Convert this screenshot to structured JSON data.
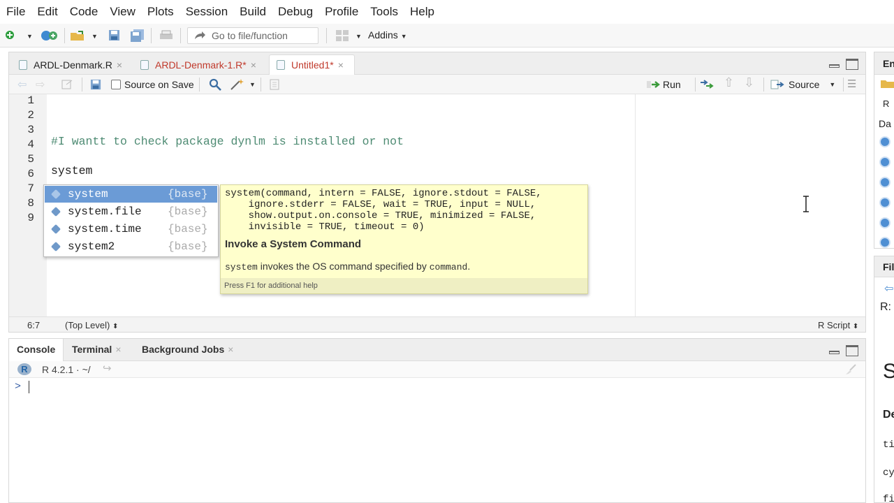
{
  "menu": [
    "File",
    "Edit",
    "Code",
    "View",
    "Plots",
    "Session",
    "Build",
    "Debug",
    "Profile",
    "Tools",
    "Help"
  ],
  "toolbar": {
    "goto_placeholder": "Go to file/function",
    "addins_label": "Addins"
  },
  "editor": {
    "tabs": [
      {
        "label": "ARDL-Denmark.R",
        "unsaved": false
      },
      {
        "label": "ARDL-Denmark-1.R*",
        "unsaved": true
      },
      {
        "label": "Untitled1*",
        "unsaved": true,
        "active": true
      }
    ],
    "toolbar": {
      "source_on_save": "Source on Save",
      "run": "Run",
      "source": "Source"
    },
    "line_numbers": [
      "1",
      "2",
      "3",
      "4",
      "5",
      "6",
      "7",
      "8",
      "9"
    ],
    "lines": [
      "",
      "",
      "",
      "#I wantt to check package dynlm is installed or not",
      "",
      "system",
      "",
      "",
      ""
    ],
    "status": {
      "position": "6:7",
      "scope": "(Top Level)",
      "file_type": "R Script"
    }
  },
  "autocomplete": {
    "items": [
      {
        "name": "system",
        "pkg": "{base}",
        "selected": true
      },
      {
        "name": "system.file",
        "pkg": "{base}",
        "selected": false
      },
      {
        "name": "system.time",
        "pkg": "{base}",
        "selected": false
      },
      {
        "name": "system2",
        "pkg": "{base}",
        "selected": false
      }
    ],
    "help": {
      "signature": "system(command, intern = FALSE, ignore.stdout = FALSE,\n    ignore.stderr = FALSE, wait = TRUE, input = NULL,\n    show.output.on.console = TRUE, minimized = FALSE,\n    invisible = TRUE, timeout = 0)",
      "title": "Invoke a System Command",
      "desc_code": "system",
      "desc_text": " invokes the OS command specified by ",
      "desc_code2": "command",
      "desc_end": ".",
      "footer": "Press F1 for additional help"
    }
  },
  "console": {
    "tabs": [
      "Console",
      "Terminal",
      "Background Jobs"
    ],
    "version": "R 4.2.1 · ~/",
    "prompt": ">"
  },
  "right_panel": {
    "top": {
      "tab": "En",
      "r_label": "R",
      "data_label": "Da"
    },
    "bottom": {
      "tab": "Fil",
      "path": "R:",
      "text1": "tir",
      "heading": "S",
      "sub": "De",
      "code1": "ti",
      "code2": "cy",
      "code3": "fi"
    }
  },
  "colors": {
    "comment": "#4e8b73",
    "selection": "#6b9bd6",
    "tooltip_bg": "#ffffcc",
    "unsaved_tab": "#c0392b"
  }
}
